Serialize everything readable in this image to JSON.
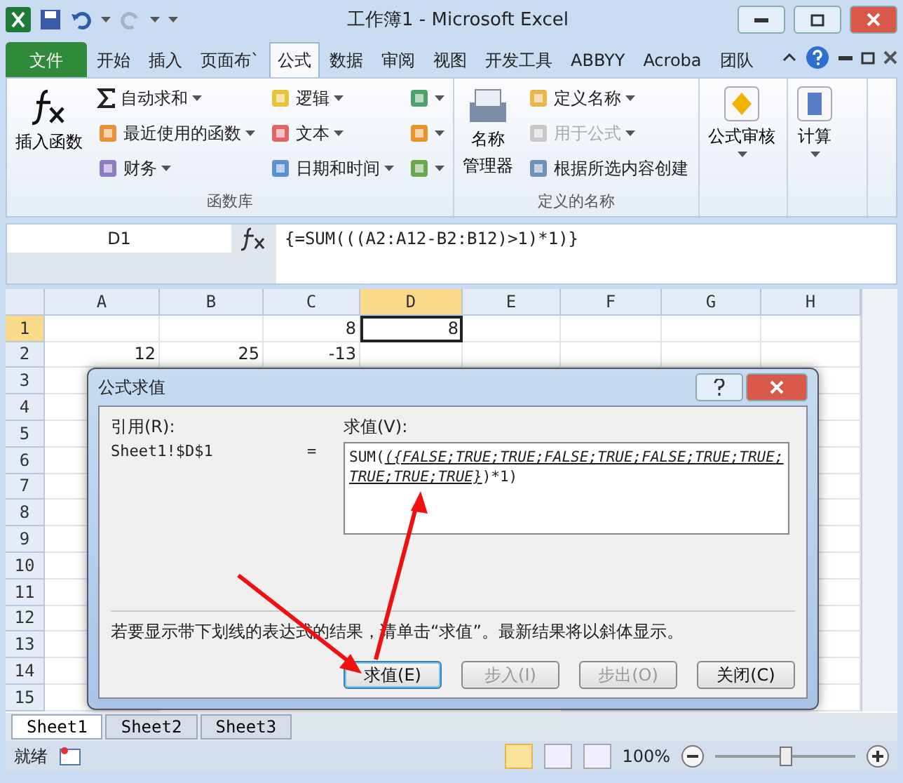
{
  "window": {
    "title": "工作簿1 - Microsoft Excel"
  },
  "ribbon_tabs": [
    {
      "label": "文件",
      "kind": "file",
      "selected": false
    },
    {
      "label": "开始",
      "kind": "tab",
      "selected": false
    },
    {
      "label": "插入",
      "kind": "tab",
      "selected": false
    },
    {
      "label": "页面布`",
      "kind": "tab",
      "selected": false
    },
    {
      "label": "公式",
      "kind": "tab",
      "selected": true
    },
    {
      "label": "数据",
      "kind": "tab",
      "selected": false
    },
    {
      "label": "审阅",
      "kind": "tab",
      "selected": false
    },
    {
      "label": "视图",
      "kind": "tab",
      "selected": false
    },
    {
      "label": "开发工具",
      "kind": "tab",
      "selected": false
    },
    {
      "label": "ABBYY",
      "kind": "tab",
      "selected": false
    },
    {
      "label": "Acroba",
      "kind": "tab",
      "selected": false
    },
    {
      "label": "团队",
      "kind": "tab",
      "selected": false
    }
  ],
  "function_library": {
    "label": "函数库",
    "insert_function": "插入函数",
    "items": [
      {
        "label": "自动求和",
        "kind": "sigma"
      },
      {
        "label": "最近使用的函数",
        "kind": "icon"
      },
      {
        "label": "财务",
        "kind": "icon"
      },
      {
        "label": "逻辑",
        "kind": "icon"
      },
      {
        "label": "文本",
        "kind": "icon"
      },
      {
        "label": "日期和时间",
        "kind": "icon"
      },
      {
        "kind": "icon"
      },
      {
        "kind": "icon"
      },
      {
        "kind": "icon"
      }
    ]
  },
  "defined_names": {
    "label": "定义的名称",
    "name_manager": [
      "名称",
      "管理器"
    ],
    "items": [
      {
        "label": "定义名称",
        "disabled": false,
        "dropdown": true
      },
      {
        "label": "用于公式",
        "disabled": true,
        "dropdown": true
      },
      {
        "label": "根据所选内容创建",
        "disabled": false,
        "dropdown": false
      }
    ]
  },
  "big_buttons": [
    {
      "label": "公式审核"
    },
    {
      "label": "计算"
    }
  ],
  "formula_bar": {
    "name_box": "D1",
    "formula": "{=SUM(((A2:A12-B2:B12)>1)*1)}"
  },
  "columns": [
    {
      "label": "A",
      "selected": false
    },
    {
      "label": "B",
      "selected": false
    },
    {
      "label": "C",
      "selected": false
    },
    {
      "label": "D",
      "selected": true
    },
    {
      "label": "E",
      "selected": false
    },
    {
      "label": "F",
      "selected": false
    },
    {
      "label": "G",
      "selected": false
    },
    {
      "label": "H",
      "selected": false
    }
  ],
  "rows": [
    {
      "label": "1",
      "selected": true,
      "cells": [
        "",
        "",
        "8",
        "8",
        "",
        "",
        "",
        ""
      ]
    },
    {
      "label": "2",
      "selected": false,
      "cells": [
        "12",
        "25",
        "-13",
        "",
        "",
        "",
        "",
        ""
      ]
    },
    {
      "label": "3",
      "selected": false
    },
    {
      "label": "4",
      "selected": false
    },
    {
      "label": "5",
      "selected": false
    },
    {
      "label": "6",
      "selected": false
    },
    {
      "label": "7",
      "selected": false
    },
    {
      "label": "8",
      "selected": false
    },
    {
      "label": "9",
      "selected": false
    },
    {
      "label": "10",
      "selected": false
    },
    {
      "label": "11",
      "selected": false
    },
    {
      "label": "12",
      "selected": false
    },
    {
      "label": "13",
      "selected": false
    },
    {
      "label": "14",
      "selected": false
    },
    {
      "label": "15",
      "selected": false
    }
  ],
  "sheet_tabs": [
    {
      "label": "Sheet1",
      "selected": true
    },
    {
      "label": "Sheet2",
      "selected": false
    },
    {
      "label": "Sheet3",
      "selected": false
    }
  ],
  "status_bar": {
    "status": "就绪",
    "zoom": "100%",
    "zoom_slider": {
      "level": 0.5
    },
    "views": [
      {
        "selected": true
      },
      {
        "selected": false
      },
      {
        "selected": false
      }
    ]
  },
  "dialog": {
    "title": "公式求值",
    "reference_label": "引用(R):",
    "reference": "Sheet1!$D$1",
    "equals": "=",
    "evaluation_label": "求值(V):",
    "evaluation": {
      "before": "SUM(",
      "underlined": "({FALSE;TRUE;TRUE;FALSE;TRUE;FALSE;TRUE;TRUE;TRUE;TRUE;TRUE}",
      "after": ")*1)"
    },
    "hint": "若要显示带下划线的表达式的结果，请单击“求值”。最新结果将以斜体显示。",
    "buttons": [
      {
        "label": "求值(E)",
        "disabled": false,
        "focused": true
      },
      {
        "label": "步入(I)",
        "disabled": true,
        "focused": false
      },
      {
        "label": "步出(O)",
        "disabled": true,
        "focused": false
      },
      {
        "label": "关闭(C)",
        "disabled": false,
        "focused": false
      }
    ]
  },
  "annotations": [
    {
      "kind": "arrow"
    },
    {
      "kind": "arrow"
    }
  ]
}
